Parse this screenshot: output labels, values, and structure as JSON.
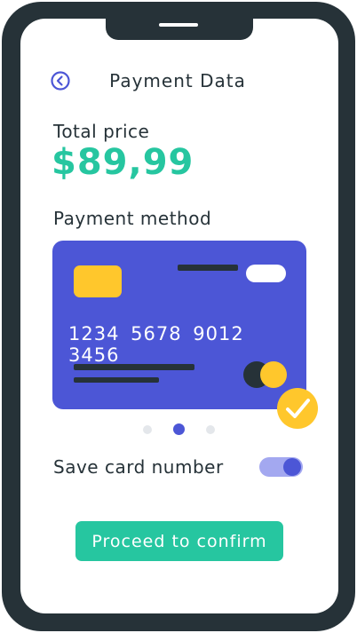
{
  "header": {
    "title": "Payment Data",
    "back_icon": "chevron-left-icon"
  },
  "total": {
    "label": "Total price",
    "value": "$89,99"
  },
  "payment": {
    "label": "Payment method",
    "card": {
      "number": "1234 5678 9012 3456",
      "selected": true
    },
    "carousel": {
      "count": 3,
      "active_index": 1
    }
  },
  "save_card": {
    "label": "Save card number",
    "enabled": true
  },
  "actions": {
    "proceed_label": "Proceed to confirm"
  },
  "colors": {
    "accent_green": "#26C6A0",
    "card_blue": "#4C56D6",
    "chip_yellow": "#FFC72C",
    "frame_dark": "#263238"
  }
}
